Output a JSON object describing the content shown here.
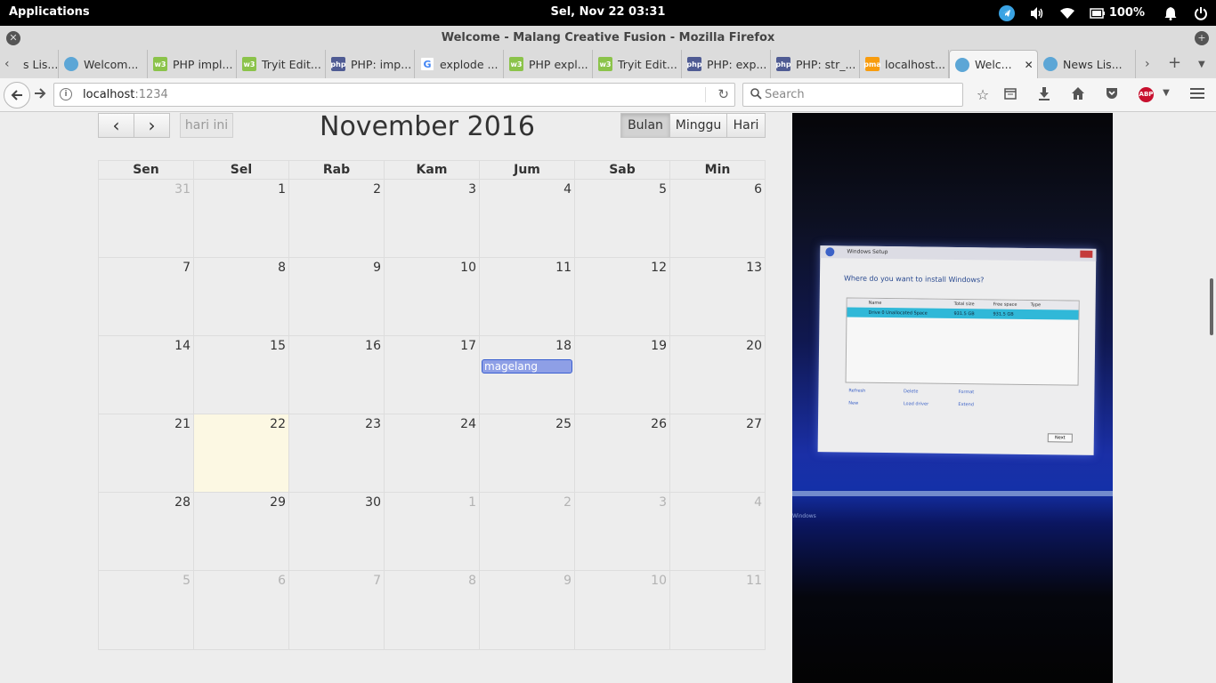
{
  "system_bar": {
    "applications_label": "Applications",
    "clock": "Sel, Nov 22   03:31",
    "battery_pct": "100%"
  },
  "window": {
    "title": "Welcome - Malang Creative Fusion - Mozilla Firefox"
  },
  "tabs": [
    {
      "label": "s Lis...",
      "icon": "news-favicon",
      "active": false
    },
    {
      "label": "Welcom...",
      "icon": "news-favicon",
      "active": false
    },
    {
      "label": "PHP impl...",
      "icon": "w3schools-favicon",
      "active": false
    },
    {
      "label": "Tryit Edit...",
      "icon": "w3schools-favicon",
      "active": false
    },
    {
      "label": "PHP: imp...",
      "icon": "php-favicon",
      "active": false
    },
    {
      "label": "explode ...",
      "icon": "google-favicon",
      "active": false
    },
    {
      "label": "PHP expl...",
      "icon": "w3schools-favicon",
      "active": false
    },
    {
      "label": "Tryit Edit...",
      "icon": "w3schools-favicon",
      "active": false
    },
    {
      "label": "PHP: exp...",
      "icon": "php-favicon",
      "active": false
    },
    {
      "label": "PHP: str_...",
      "icon": "php-favicon",
      "active": false
    },
    {
      "label": "localhost...",
      "icon": "phpmyadmin-favicon",
      "active": false
    },
    {
      "label": "Welc...",
      "icon": "news-favicon",
      "active": true
    },
    {
      "label": "News Lis...",
      "icon": "news-favicon",
      "active": false
    }
  ],
  "navbar": {
    "url_host": "localhost",
    "url_port": ":1234",
    "search_placeholder": "Search",
    "abp_label": "ABP"
  },
  "calendar": {
    "title": "November 2016",
    "today_button": "hari ini",
    "prev_glyph": "‹",
    "next_glyph": "›",
    "views": [
      "Bulan",
      "Minggu",
      "Hari"
    ],
    "active_view": "Bulan",
    "weekdays": [
      "Sen",
      "Sel",
      "Rab",
      "Kam",
      "Jum",
      "Sab",
      "Min"
    ],
    "weeks": [
      [
        {
          "d": "31",
          "other": true
        },
        {
          "d": "1"
        },
        {
          "d": "2"
        },
        {
          "d": "3"
        },
        {
          "d": "4"
        },
        {
          "d": "5"
        },
        {
          "d": "6"
        }
      ],
      [
        {
          "d": "7"
        },
        {
          "d": "8"
        },
        {
          "d": "9"
        },
        {
          "d": "10"
        },
        {
          "d": "11"
        },
        {
          "d": "12"
        },
        {
          "d": "13"
        }
      ],
      [
        {
          "d": "14"
        },
        {
          "d": "15"
        },
        {
          "d": "16"
        },
        {
          "d": "17"
        },
        {
          "d": "18",
          "event": "magelang"
        },
        {
          "d": "19"
        },
        {
          "d": "20"
        }
      ],
      [
        {
          "d": "21"
        },
        {
          "d": "22",
          "today": true
        },
        {
          "d": "23"
        },
        {
          "d": "24"
        },
        {
          "d": "25"
        },
        {
          "d": "26"
        },
        {
          "d": "27"
        }
      ],
      [
        {
          "d": "28"
        },
        {
          "d": "29"
        },
        {
          "d": "30"
        },
        {
          "d": "1",
          "other": true
        },
        {
          "d": "2",
          "other": true
        },
        {
          "d": "3",
          "other": true
        },
        {
          "d": "4",
          "other": true
        }
      ],
      [
        {
          "d": "5",
          "other": true
        },
        {
          "d": "6",
          "other": true
        },
        {
          "d": "7",
          "other": true
        },
        {
          "d": "8",
          "other": true
        },
        {
          "d": "9",
          "other": true
        },
        {
          "d": "10",
          "other": true
        },
        {
          "d": "11",
          "other": true
        }
      ]
    ],
    "colors": {
      "today_bg": "#fcf8e3",
      "event_bg": "#8e9fe6",
      "event_border": "#3a5fd0"
    }
  },
  "photo": {
    "dialog_title": "Windows Setup",
    "question": "Where do you want to install Windows?",
    "columns": [
      "Name",
      "Total size",
      "Free space",
      "Type"
    ],
    "row": [
      "Drive 0 Unallocated Space",
      "931.5 GB",
      "931.5 GB",
      ""
    ],
    "actions": [
      "Refresh",
      "Delete",
      "Format",
      "New",
      "Load driver",
      "Extend"
    ],
    "next_label": "Next",
    "monitor_caption": "Windows"
  }
}
